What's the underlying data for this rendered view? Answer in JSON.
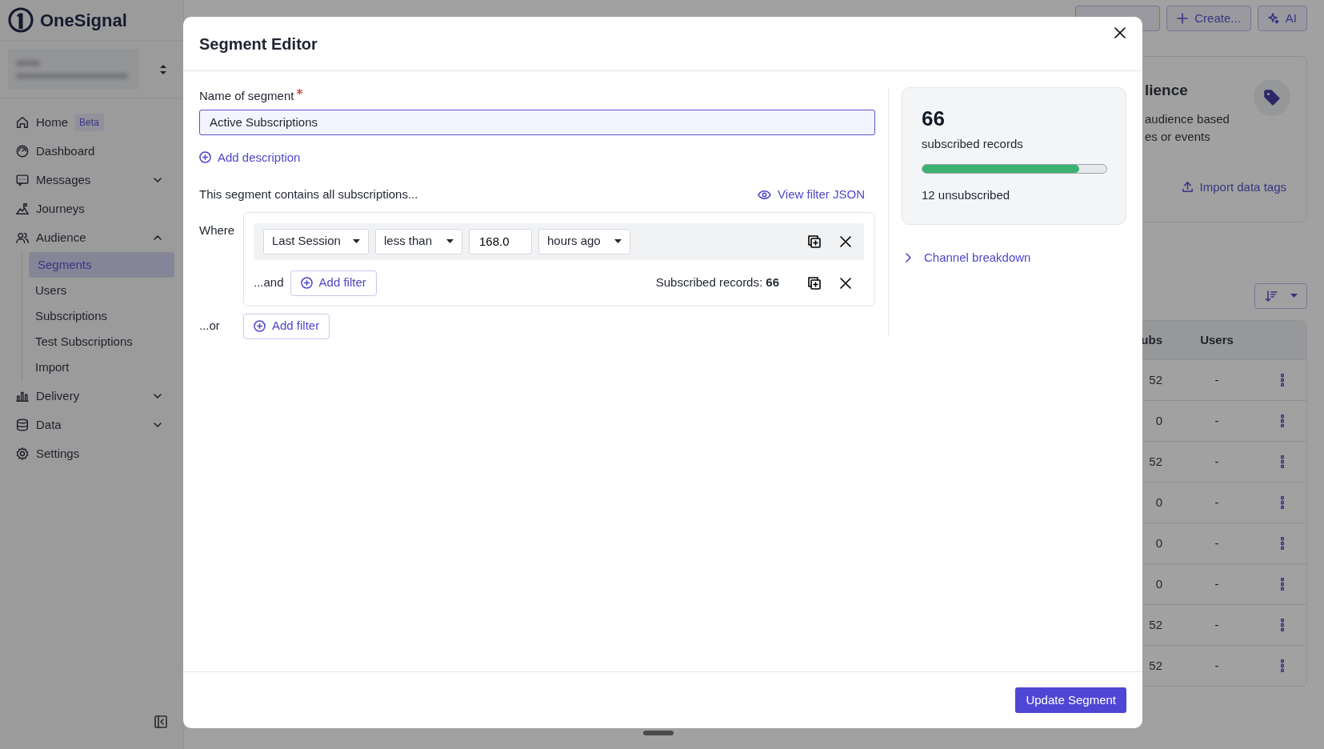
{
  "sidebar": {
    "brand": "OneSignal",
    "items": [
      {
        "kind": "link",
        "label": "Home",
        "badge": "Beta"
      },
      {
        "kind": "link",
        "label": "Dashboard"
      },
      {
        "kind": "group",
        "label": "Messages",
        "expanded": false
      },
      {
        "kind": "link",
        "label": "Journeys"
      },
      {
        "kind": "group",
        "label": "Audience",
        "expanded": true,
        "children": [
          {
            "label": "Segments",
            "selected": true
          },
          {
            "label": "Users",
            "selected": false
          },
          {
            "label": "Subscriptions",
            "selected": false
          },
          {
            "label": "Test Subscriptions",
            "selected": false
          },
          {
            "label": "Import",
            "selected": false
          }
        ]
      },
      {
        "kind": "group",
        "label": "Delivery",
        "expanded": false
      },
      {
        "kind": "group",
        "label": "Data",
        "expanded": false
      },
      {
        "kind": "link",
        "label": "Settings"
      }
    ]
  },
  "header": {
    "buttons": [
      "Create...",
      "AI"
    ]
  },
  "background": {
    "card": {
      "heading": "lience",
      "lines": [
        "audience based",
        "es or events"
      ],
      "link": "Import data tags"
    },
    "table": {
      "columns": [
        "ubs",
        "Users"
      ],
      "rows": [
        {
          "subs": "52",
          "users": "-"
        },
        {
          "subs": "0",
          "users": "-"
        },
        {
          "subs": "52",
          "users": "-"
        },
        {
          "subs": "0",
          "users": "-"
        },
        {
          "subs": "0",
          "users": "-"
        },
        {
          "subs": "0",
          "users": "-"
        },
        {
          "subs": "52",
          "users": "-"
        },
        {
          "subs": "52",
          "users": "-"
        }
      ]
    }
  },
  "modal": {
    "title": "Segment Editor",
    "name_label": "Name of segment",
    "required": true,
    "name_value": "Active Subscriptions",
    "add_description": "Add description",
    "intro": "This segment contains all subscriptions...",
    "view_json": "View filter JSON",
    "where_label": "Where",
    "filter": {
      "field": "Last Session",
      "operator": "less than",
      "value": "168.0",
      "unit": "hours ago"
    },
    "and_label": "...and",
    "and_add_filter": "Add filter",
    "records_text": "Subscribed records: **66**",
    "or_label": "...or",
    "or_add_filter": "Add filter",
    "summary": {
      "count": "66",
      "label": "subscribed records",
      "level": 0.85,
      "unsubscribed": "12 unsubscribed"
    },
    "channel_breakdown": {
      "label": "Channel breakdown",
      "expanded": false
    },
    "submit": "Update Segment"
  }
}
